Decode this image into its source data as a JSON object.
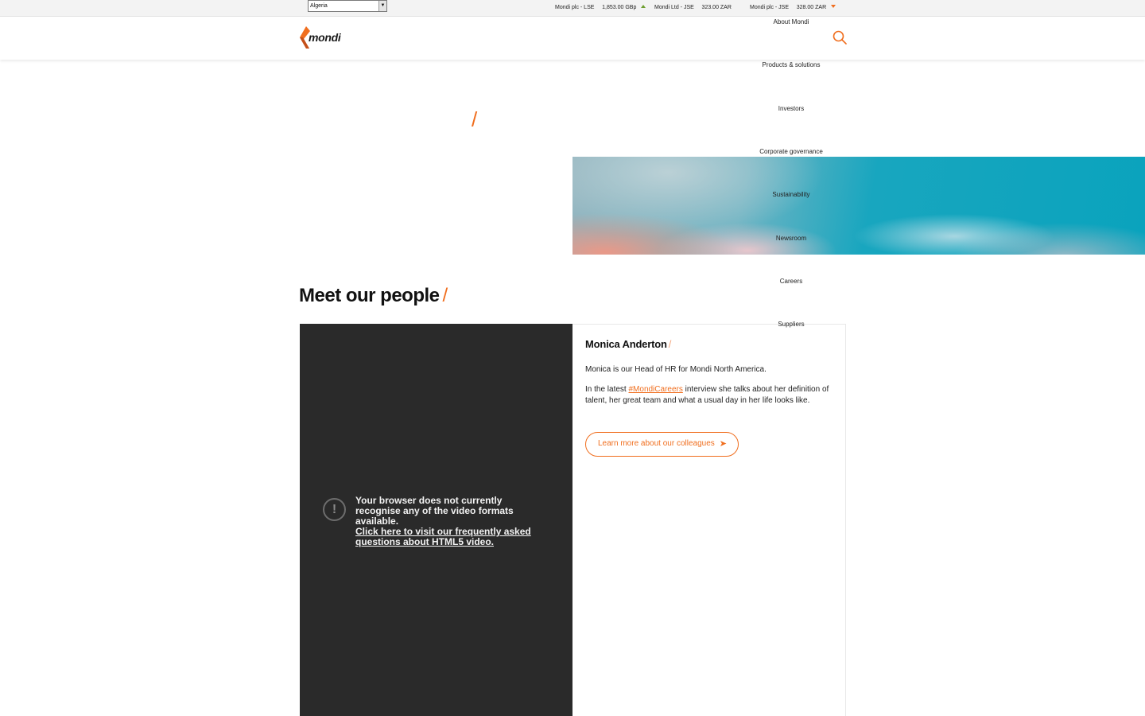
{
  "topbar": {
    "country_selected": "Algeria",
    "tickers": [
      {
        "label": "Mondi plc - LSE",
        "value": "1,853.00 GBp",
        "trend": "up"
      },
      {
        "label": "Mondi Ltd - JSE",
        "value": "323.00 ZAR",
        "trend": "none"
      },
      {
        "label": "Mondi plc - JSE",
        "value": "328.00 ZAR",
        "trend": "down"
      }
    ]
  },
  "header": {
    "logo_text": "mondi",
    "nav": [
      "About Mondi",
      "Products & solutions",
      "Investors",
      "Corporate governance",
      "Sustainability",
      "Newsroom",
      "Careers",
      "Suppliers"
    ]
  },
  "hero": {
    "slash": "/"
  },
  "section": {
    "title": "Meet our people",
    "slash": "/"
  },
  "video": {
    "message": "Your browser does not currently recognise any of the video formats available.",
    "link": "Click here to visit our frequently asked questions about HTML5 video.",
    "icon": "!"
  },
  "person": {
    "name": "Monica Anderton",
    "slash": "/",
    "intro": "Monica is our Head of HR for Mondi North America.",
    "text_before": "In the latest ",
    "hashtag": "#MondiCareers",
    "text_after": " interview she talks about her definition of talent, her great team and what a usual day in her life looks like.",
    "cta": "Learn more about our colleagues",
    "cta_icon": "➤"
  },
  "colors": {
    "accent": "#f06e1e",
    "video_bg": "#2a2a2a"
  }
}
